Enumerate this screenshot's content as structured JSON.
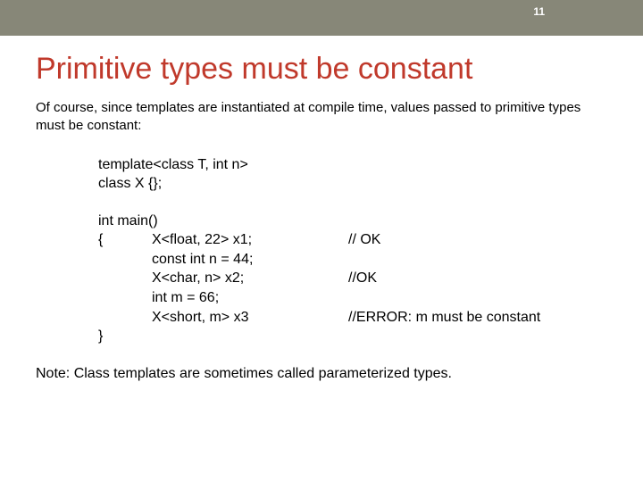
{
  "page_number": "11",
  "title": "Primitive types must be constant",
  "intro": "Of course, since templates are instantiated at compile time, values passed to primitive types must be constant:",
  "code": {
    "decl1": "template<class T, int n>",
    "decl2": "class X {};",
    "main_open": "int main()",
    "brace_open": "{",
    "line1": "X<float, 22> x1;",
    "line1_comment": "// OK",
    "line2": "const int n = 44;",
    "line3": "X<char, n> x2;",
    "line3_comment": "//OK",
    "line4": "int m = 66;",
    "line5": "X<short, m> x3",
    "line5_comment": "//ERROR: m must be constant",
    "brace_close": "}"
  },
  "note": "Note: Class templates are sometimes called parameterized types."
}
